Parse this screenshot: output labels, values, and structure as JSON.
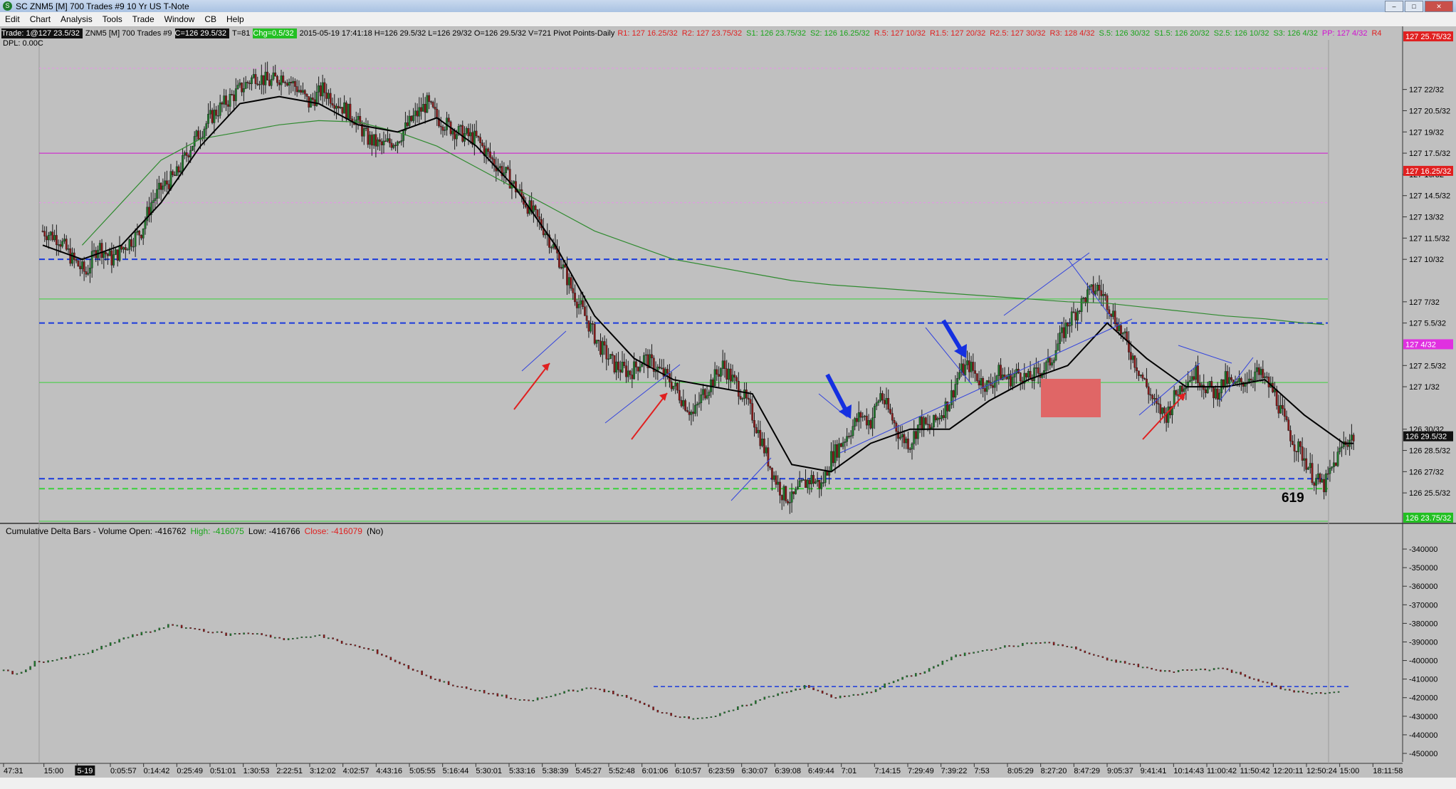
{
  "window": {
    "title": "SC ZNM5 [M]  700 Trades  #9  10 Yr US T-Note",
    "buttons": [
      "–",
      "□",
      "✕"
    ]
  },
  "menu": [
    "Edit",
    "Chart",
    "Analysis",
    "Tools",
    "Trade",
    "Window",
    "CB",
    "Help"
  ],
  "info_bar": {
    "trade": "Trade: 1@127 23.5/32",
    "symbol": "ZNM5 [M]  700 Trades  #9",
    "close": "C=126 29.5/32",
    "t": "T=81",
    "chg": "Chg=0.5/32",
    "ohlc": "2015-05-19 17:41:18 H=126 29.5/32 L=126 29/32 O=126 29.5/32 V=721 Pivot Points-Daily",
    "pivots": [
      {
        "text": "R1: 127 16.25/32",
        "color": "#e02020"
      },
      {
        "text": "R2: 127 23.75/32",
        "color": "#e02020"
      },
      {
        "text": "S1: 126 23.75/32",
        "color": "#1aa51a"
      },
      {
        "text": "S2: 126 16.25/32",
        "color": "#1aa51a"
      },
      {
        "text": "R.5: 127 10/32",
        "color": "#e02020"
      },
      {
        "text": "R1.5: 127 20/32",
        "color": "#e02020"
      },
      {
        "text": "R2.5: 127 30/32",
        "color": "#e02020"
      },
      {
        "text": "R3: 128 4/32",
        "color": "#e02020"
      },
      {
        "text": "S.5: 126 30/32",
        "color": "#1aa51a"
      },
      {
        "text": "S1.5: 126 20/32",
        "color": "#1aa51a"
      },
      {
        "text": "S2.5: 126 10/32",
        "color": "#1aa51a"
      },
      {
        "text": "S3: 126 4/32",
        "color": "#1aa51a"
      },
      {
        "text": "PP: 127 4/32",
        "color": "#d010d0"
      },
      {
        "text": "R4",
        "color": "#e02020"
      }
    ],
    "dpl": "DPL: 0.00C"
  },
  "chart_data": {
    "type": "candlestick",
    "price_axis_labels": [
      "127 22/32",
      "127 20.5/32",
      "127 19/32",
      "127 17.5/32",
      "127 16.25/32",
      "127 14.5/32",
      "127 13/32",
      "127 11.5/32",
      "127 10/32",
      "127 7/32",
      "127 5.5/32",
      "127 4/32",
      "127 2.5/32",
      "127 1/32",
      "126 30/32",
      "126 29.5/32",
      "126 28.5/32",
      "126 27/32",
      "126 25.5/32"
    ],
    "price_ticks": [
      22,
      20.5,
      19,
      17.5,
      16,
      14.5,
      13,
      11.5,
      10,
      7,
      5.5,
      2.5,
      1,
      -2,
      -3.5,
      -5,
      -6.5
    ],
    "price_tick_labels": [
      "127 22/32",
      "127 20.5/32",
      "127 19/32",
      "127 17.5/32",
      "127 16/32",
      "127 14.5/32",
      "127 13/32",
      "127 11.5/32",
      "127 10/32",
      "127 7/32",
      "127 5.5/32",
      "127 2.5/32",
      "127 1/32",
      "126 30/32",
      "126 28.5/32",
      "126 27/32",
      "126 25.5/32"
    ],
    "price_ylim": [
      -8,
      25
    ],
    "price_tags": [
      {
        "label": "127 16.25/32",
        "y": 16.25,
        "bg": "#e02020",
        "fg": "#ffffff"
      },
      {
        "label": "127 4/32",
        "y": 4,
        "bg": "#e030e0",
        "fg": "#ffffff"
      },
      {
        "label": "126 29.5/32",
        "y": -2.5,
        "bg": "#111111",
        "fg": "#ffffff"
      },
      {
        "label": "127 25.75/32",
        "y": 25.75,
        "bg": "#e02020",
        "fg": "#ffffff"
      },
      {
        "label": "126 23.75/32",
        "y": -8.25,
        "bg": "#22c022",
        "fg": "#ffffff"
      }
    ],
    "time_labels": [
      "47:31",
      "15:00",
      "5-19",
      "0:05:57",
      "0:14:42",
      "0:25:49",
      "0:51:01",
      "1:30:53",
      "2:22:51",
      "3:12:02",
      "4:02:57",
      "4:43:16",
      "5:05:55",
      "5:16:44",
      "5:30:01",
      "5:33:16",
      "5:38:39",
      "5:45:27",
      "5:52:48",
      "6:01:06",
      "6:10:57",
      "6:23:59",
      "6:30:07",
      "6:39:08",
      "6:49:44",
      "7:01",
      "7:14:15",
      "7:29:49",
      "7:39:22",
      "7:53",
      "8:05:29",
      "8:27:20",
      "8:47:29",
      "9:05:37",
      "9:41:41",
      "10:14:43",
      "11:00:42",
      "11:50:42",
      "12:20:11",
      "12:50:24",
      "15:00",
      "18:11:58"
    ],
    "close_path": [
      [
        0,
        12
      ],
      [
        8,
        11.5
      ],
      [
        15,
        10
      ],
      [
        22,
        9
      ],
      [
        28,
        11
      ],
      [
        35,
        10
      ],
      [
        42,
        11
      ],
      [
        50,
        12
      ],
      [
        55,
        14
      ],
      [
        60,
        15
      ],
      [
        68,
        16
      ],
      [
        75,
        18
      ],
      [
        85,
        20
      ],
      [
        92,
        21
      ],
      [
        100,
        22
      ],
      [
        108,
        23
      ],
      [
        115,
        22.5
      ],
      [
        122,
        23
      ],
      [
        130,
        22
      ],
      [
        135,
        21
      ],
      [
        142,
        22
      ],
      [
        150,
        21
      ],
      [
        158,
        20
      ],
      [
        165,
        18.5
      ],
      [
        172,
        18
      ],
      [
        180,
        18.5
      ],
      [
        188,
        20
      ],
      [
        195,
        21
      ],
      [
        200,
        20
      ],
      [
        210,
        19
      ],
      [
        220,
        18.5
      ],
      [
        228,
        17
      ],
      [
        235,
        16
      ],
      [
        245,
        14
      ],
      [
        255,
        12
      ],
      [
        262,
        10
      ],
      [
        268,
        8
      ],
      [
        275,
        6
      ],
      [
        282,
        4
      ],
      [
        290,
        2.5
      ],
      [
        298,
        2
      ],
      [
        305,
        3
      ],
      [
        310,
        2.5
      ],
      [
        318,
        1.5
      ],
      [
        325,
        0
      ],
      [
        330,
        -1
      ],
      [
        335,
        0.5
      ],
      [
        340,
        1.5
      ],
      [
        345,
        2.5
      ],
      [
        350,
        1.5
      ],
      [
        355,
        0.5
      ],
      [
        360,
        -1
      ],
      [
        365,
        -3
      ],
      [
        370,
        -5
      ],
      [
        375,
        -6.5
      ],
      [
        380,
        -7
      ],
      [
        385,
        -6
      ],
      [
        390,
        -5.5
      ],
      [
        395,
        -6
      ],
      [
        400,
        -4
      ],
      [
        405,
        -3
      ],
      [
        410,
        -2
      ],
      [
        415,
        -1
      ],
      [
        420,
        -1.5
      ],
      [
        425,
        0.5
      ],
      [
        430,
        -1
      ],
      [
        435,
        -2.5
      ],
      [
        440,
        -3
      ],
      [
        445,
        -1.5
      ],
      [
        450,
        -2
      ],
      [
        455,
        -1
      ],
      [
        460,
        0
      ],
      [
        465,
        2
      ],
      [
        470,
        2.5
      ],
      [
        475,
        1.5
      ],
      [
        480,
        1
      ],
      [
        485,
        2
      ],
      [
        490,
        1.5
      ],
      [
        495,
        2
      ],
      [
        500,
        1.5
      ],
      [
        505,
        2
      ],
      [
        510,
        2.5
      ],
      [
        515,
        4
      ],
      [
        520,
        5.5
      ],
      [
        525,
        6.5
      ],
      [
        530,
        7.5
      ],
      [
        535,
        8
      ],
      [
        540,
        7
      ],
      [
        545,
        5.5
      ],
      [
        550,
        4
      ],
      [
        555,
        2.5
      ],
      [
        560,
        1
      ],
      [
        565,
        -0.5
      ],
      [
        570,
        -1
      ],
      [
        575,
        0.5
      ],
      [
        580,
        1.5
      ],
      [
        585,
        2
      ],
      [
        590,
        1
      ],
      [
        595,
        0.5
      ],
      [
        600,
        1.5
      ],
      [
        605,
        1
      ],
      [
        610,
        1.5
      ],
      [
        615,
        2
      ],
      [
        620,
        1.5
      ],
      [
        625,
        0.5
      ],
      [
        630,
        -1.5
      ],
      [
        635,
        -3
      ],
      [
        640,
        -4
      ],
      [
        645,
        -5.5
      ],
      [
        650,
        -6
      ],
      [
        655,
        -4.5
      ],
      [
        660,
        -3
      ],
      [
        665,
        -2.5
      ]
    ],
    "sma_fast_path": [
      [
        0,
        11
      ],
      [
        20,
        10
      ],
      [
        40,
        11
      ],
      [
        60,
        14
      ],
      [
        80,
        18
      ],
      [
        100,
        21
      ],
      [
        120,
        21.5
      ],
      [
        140,
        21
      ],
      [
        160,
        19.5
      ],
      [
        180,
        19
      ],
      [
        200,
        20
      ],
      [
        220,
        18
      ],
      [
        240,
        15
      ],
      [
        260,
        11
      ],
      [
        280,
        6
      ],
      [
        300,
        3
      ],
      [
        320,
        1.5
      ],
      [
        340,
        1
      ],
      [
        360,
        0.5
      ],
      [
        380,
        -4.5
      ],
      [
        400,
        -5
      ],
      [
        420,
        -3
      ],
      [
        440,
        -2
      ],
      [
        460,
        -2
      ],
      [
        480,
        0
      ],
      [
        500,
        1.5
      ],
      [
        520,
        2.5
      ],
      [
        540,
        5.5
      ],
      [
        560,
        3
      ],
      [
        580,
        1
      ],
      [
        600,
        1
      ],
      [
        620,
        1.5
      ],
      [
        640,
        -1
      ],
      [
        660,
        -3
      ],
      [
        665,
        -3
      ]
    ],
    "sma_slow_path": [
      [
        20,
        11
      ],
      [
        40,
        14
      ],
      [
        60,
        17
      ],
      [
        80,
        18.5
      ],
      [
        100,
        19
      ],
      [
        120,
        19.5
      ],
      [
        140,
        19.8
      ],
      [
        160,
        19.7
      ],
      [
        180,
        19
      ],
      [
        200,
        18
      ],
      [
        220,
        16.5
      ],
      [
        240,
        15
      ],
      [
        260,
        13.5
      ],
      [
        280,
        12
      ],
      [
        300,
        11
      ],
      [
        320,
        10
      ],
      [
        340,
        9.5
      ],
      [
        360,
        9
      ],
      [
        380,
        8.5
      ],
      [
        400,
        8.2
      ],
      [
        420,
        8
      ],
      [
        440,
        7.8
      ],
      [
        460,
        7.6
      ],
      [
        480,
        7.4
      ],
      [
        500,
        7.2
      ],
      [
        520,
        7
      ],
      [
        540,
        6.9
      ],
      [
        560,
        6.6
      ],
      [
        580,
        6.3
      ],
      [
        600,
        6
      ],
      [
        620,
        5.8
      ],
      [
        640,
        5.5
      ],
      [
        650,
        5.4
      ]
    ],
    "pivot_levels": [
      {
        "name": "R2.5",
        "y": 23.5,
        "color": "#e890e8",
        "style": "dotted"
      },
      {
        "name": "R2",
        "y": 17.5,
        "color": "#d010d0",
        "style": "solid"
      },
      {
        "name": "R1.5",
        "y": 14,
        "color": "#e890e8",
        "style": "dotted"
      },
      {
        "name": "upper",
        "y": 10,
        "color": "#1a3adc",
        "style": "dashed"
      },
      {
        "name": "PP",
        "y": 7.2,
        "color": "#3bd03b",
        "style": "solid"
      },
      {
        "name": "mid",
        "y": 5.5,
        "color": "#1a3adc",
        "style": "dashed"
      },
      {
        "name": "S.5",
        "y": 1.3,
        "color": "#3bd03b",
        "style": "solid"
      },
      {
        "name": "support",
        "y": -5.5,
        "color": "#1a3adc",
        "style": "dashed"
      },
      {
        "name": "S1",
        "y": -6.2,
        "color": "#3bd03b",
        "style": "dashed"
      },
      {
        "name": "S1.5",
        "y": -8.5,
        "color": "#3bd03b",
        "style": "solid"
      }
    ],
    "annotation_label": "619",
    "subchart": {
      "title_parts": [
        {
          "text": "Cumulative Delta Bars - Volume  Open: -416762",
          "color": "#000000"
        },
        {
          "text": "High: -416075",
          "color": "#1aa51a"
        },
        {
          "text": "Low: -416766",
          "color": "#000000"
        },
        {
          "text": "Close: -416079",
          "color": "#e02020"
        },
        {
          "text": "(No)",
          "color": "#000000"
        }
      ],
      "ylim": [
        -450000,
        -335000
      ],
      "ticks": [
        -340000,
        -350000,
        -360000,
        -370000,
        -380000,
        -390000,
        -400000,
        -410000,
        -420000,
        -430000,
        -440000,
        -450000
      ],
      "tick_labels": [
        "-340000",
        "-350000",
        "-360000",
        "-370000",
        "-380000",
        "-390000",
        "-400000",
        "-410000",
        "-420000",
        "-430000",
        "-440000",
        "-450000"
      ],
      "reference_level": -414000,
      "values": [
        [
          0,
          -405000
        ],
        [
          10,
          -408000
        ],
        [
          20,
          -401000
        ],
        [
          40,
          -399000
        ],
        [
          60,
          -395000
        ],
        [
          80,
          -388000
        ],
        [
          100,
          -384000
        ],
        [
          110,
          -381000
        ],
        [
          130,
          -383000
        ],
        [
          150,
          -386000
        ],
        [
          170,
          -385000
        ],
        [
          190,
          -389000
        ],
        [
          210,
          -386000
        ],
        [
          230,
          -391000
        ],
        [
          250,
          -395000
        ],
        [
          270,
          -403000
        ],
        [
          290,
          -410000
        ],
        [
          310,
          -415000
        ],
        [
          330,
          -418000
        ],
        [
          350,
          -422000
        ],
        [
          370,
          -419000
        ],
        [
          380,
          -416000
        ],
        [
          400,
          -415000
        ],
        [
          420,
          -420000
        ],
        [
          440,
          -427000
        ],
        [
          460,
          -431000
        ],
        [
          480,
          -430000
        ],
        [
          500,
          -424000
        ],
        [
          520,
          -418000
        ],
        [
          540,
          -414000
        ],
        [
          560,
          -420000
        ],
        [
          580,
          -418000
        ],
        [
          600,
          -411000
        ],
        [
          620,
          -406000
        ],
        [
          640,
          -398000
        ],
        [
          660,
          -394000
        ],
        [
          680,
          -392000
        ],
        [
          700,
          -390000
        ],
        [
          720,
          -393000
        ],
        [
          740,
          -399000
        ],
        [
          760,
          -402000
        ],
        [
          780,
          -406000
        ],
        [
          800,
          -405000
        ],
        [
          820,
          -404000
        ],
        [
          840,
          -409000
        ],
        [
          860,
          -415000
        ],
        [
          880,
          -418000
        ],
        [
          900,
          -417000
        ]
      ]
    }
  }
}
